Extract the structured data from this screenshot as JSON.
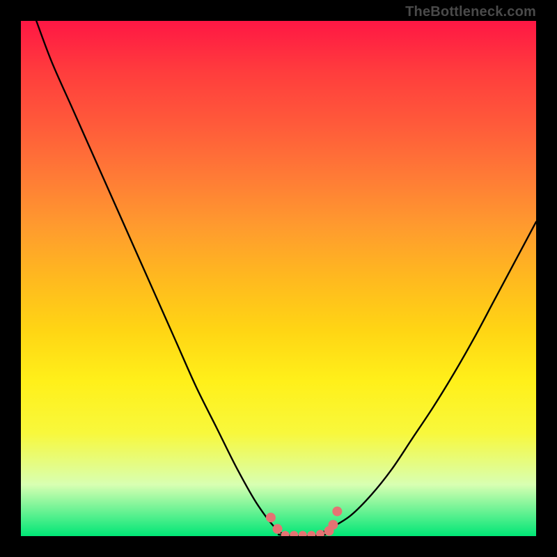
{
  "attribution": "TheBottleneck.com",
  "chart_data": {
    "type": "line",
    "title": "",
    "xlabel": "",
    "ylabel": "",
    "xlim": [
      0,
      100
    ],
    "ylim": [
      0,
      100
    ],
    "grid": false,
    "legend": false,
    "series": [
      {
        "name": "left-curve",
        "x": [
          3,
          6,
          10,
          14,
          18,
          22,
          26,
          30,
          34,
          38,
          42,
          46,
          50,
          53
        ],
        "y": [
          100,
          92,
          83,
          74,
          65,
          56,
          47,
          38,
          29,
          21,
          13,
          6,
          1,
          0
        ]
      },
      {
        "name": "right-curve",
        "x": [
          57,
          60,
          64,
          68,
          72,
          76,
          80,
          84,
          88,
          92,
          96,
          100
        ],
        "y": [
          0,
          1.5,
          4,
          8,
          13,
          19,
          25,
          31.5,
          38.5,
          46,
          53.5,
          61
        ]
      },
      {
        "name": "flat-bottom",
        "x": [
          50,
          52,
          54,
          56,
          58,
          60
        ],
        "y": [
          0.3,
          0.0,
          0.0,
          0.0,
          0.0,
          0.6
        ]
      }
    ],
    "markers": [
      {
        "x": 48.5,
        "y": 3.6,
        "r": 7
      },
      {
        "x": 49.8,
        "y": 1.4,
        "r": 7
      },
      {
        "x": 51.3,
        "y": 0.2,
        "r": 6
      },
      {
        "x": 53.0,
        "y": 0.2,
        "r": 6
      },
      {
        "x": 54.7,
        "y": 0.2,
        "r": 6
      },
      {
        "x": 56.4,
        "y": 0.2,
        "r": 6
      },
      {
        "x": 58.1,
        "y": 0.4,
        "r": 6
      },
      {
        "x": 59.8,
        "y": 1.0,
        "r": 7
      },
      {
        "x": 60.6,
        "y": 2.2,
        "r": 7
      },
      {
        "x": 61.4,
        "y": 4.8,
        "r": 7
      }
    ],
    "marker_color": "#e57373",
    "curve_color": "#000000",
    "curve_width": 2.4
  }
}
